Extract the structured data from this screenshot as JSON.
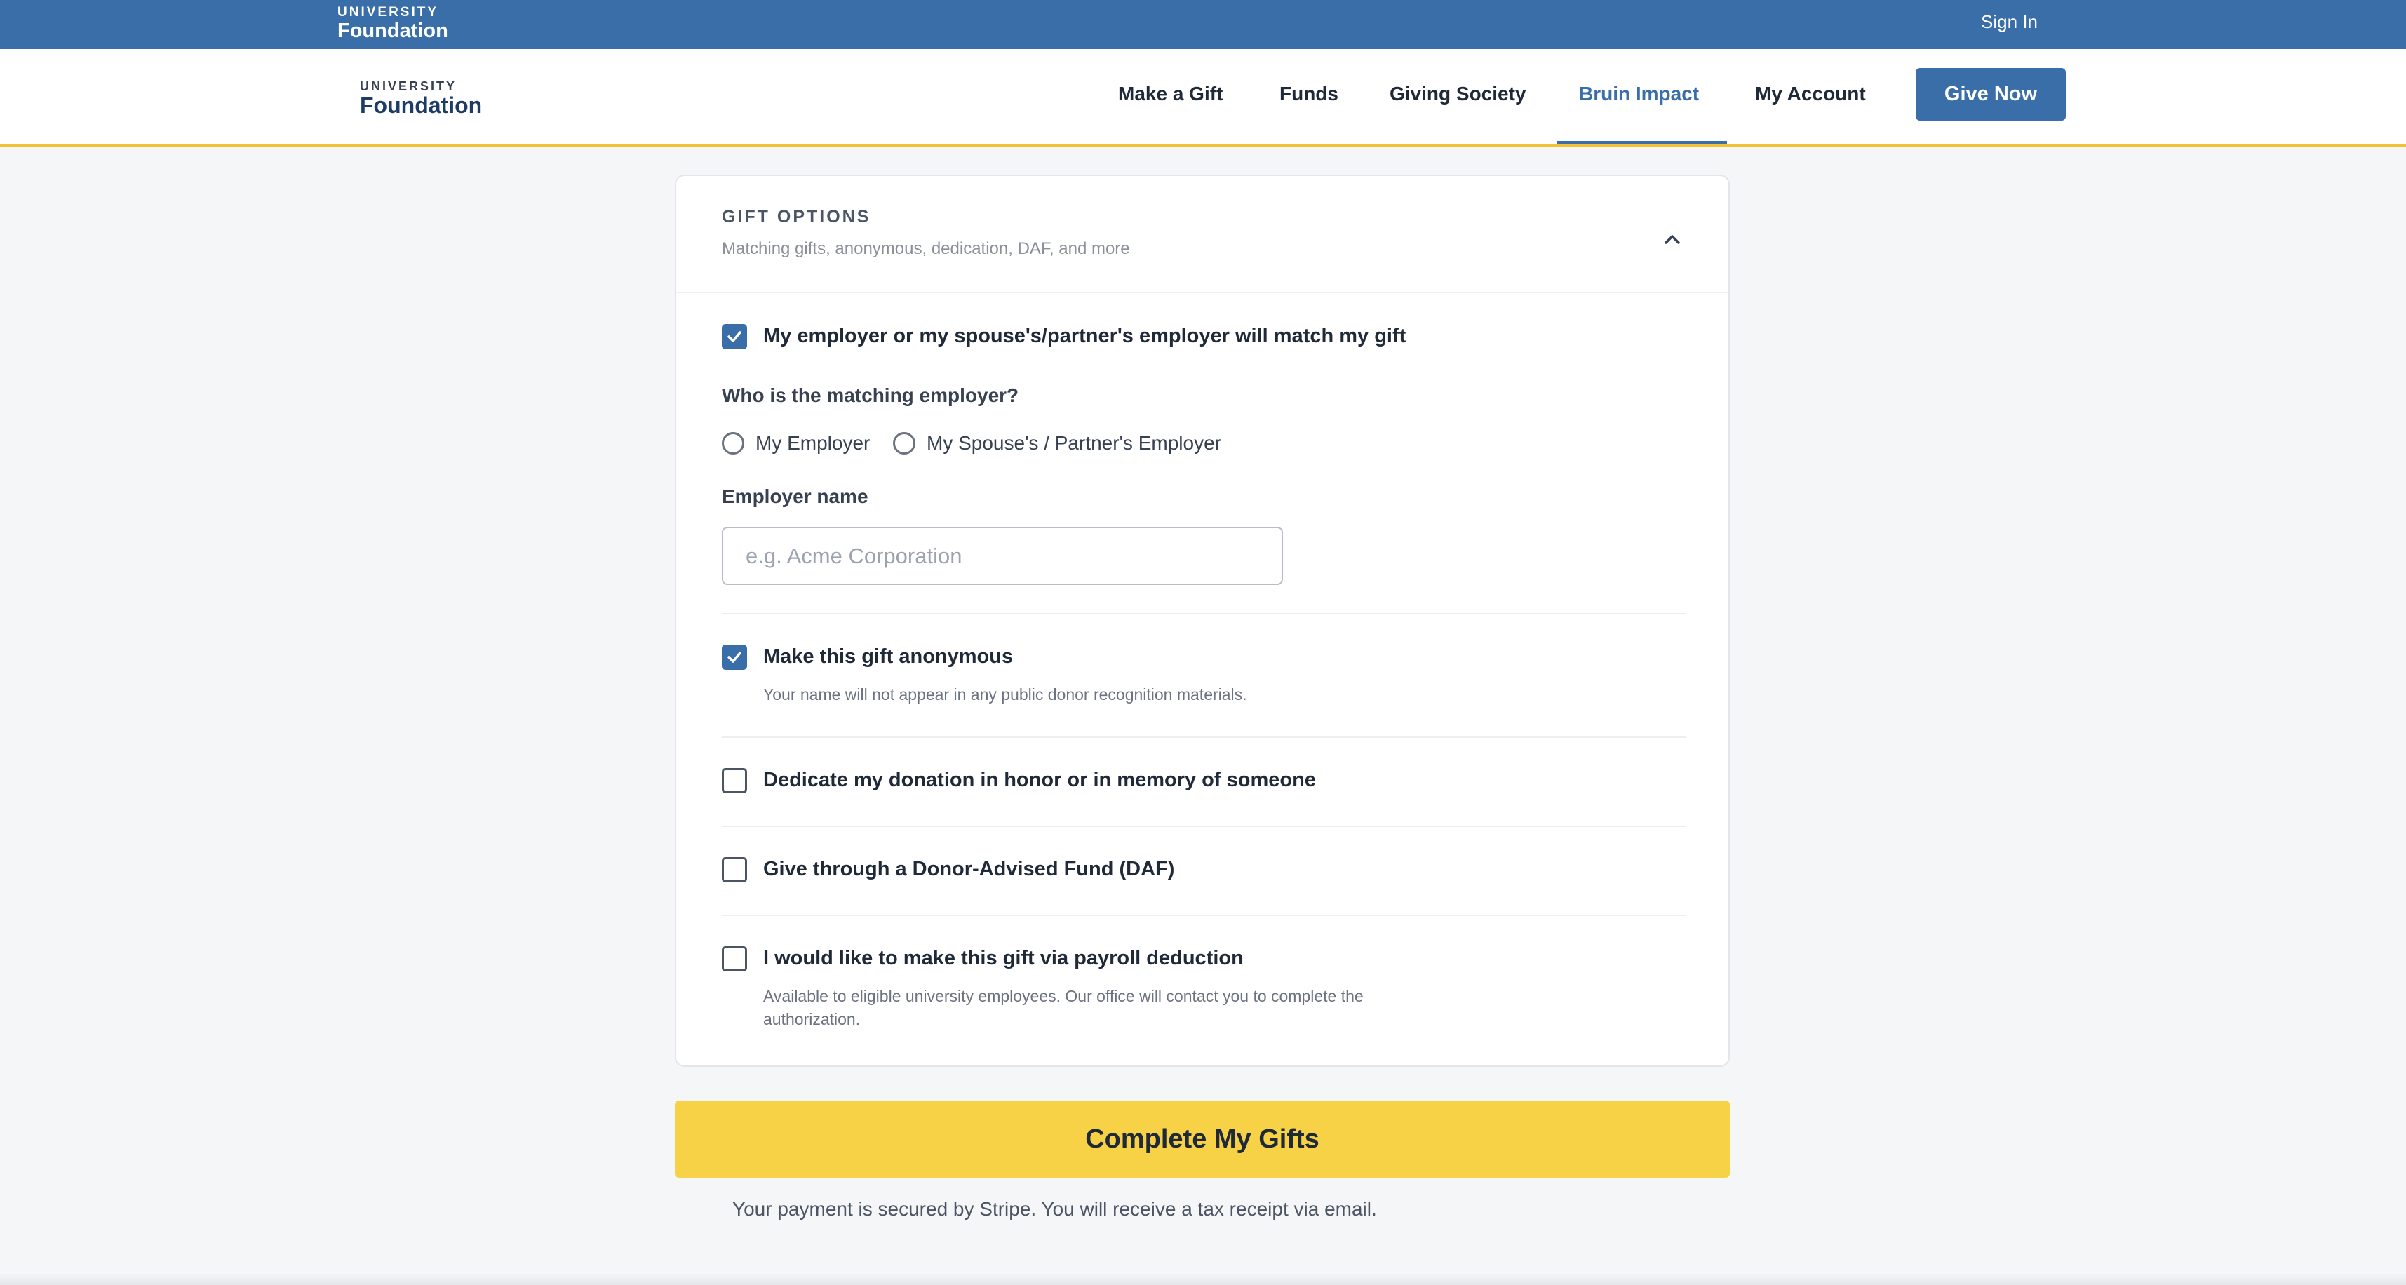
{
  "utility_bar": {
    "logo_small": "UNIVERSITY",
    "logo_big": "Foundation",
    "sign_in": "Sign In"
  },
  "nav": {
    "logo_small": "UNIVERSITY",
    "logo_big": "Foundation",
    "links": [
      "Make a Gift",
      "Funds",
      "Giving Society",
      "Bruin Impact",
      "My Account"
    ],
    "active_link": "Bruin Impact",
    "give_now": "Give Now"
  },
  "gift_options": {
    "title": "GIFT OPTIONS",
    "subtitle": "Matching gifts, anonymous, dedication, DAF, and more",
    "expanded": true,
    "matching": {
      "label": "My employer or my spouse's/partner's employer will match my gift",
      "checked": true,
      "question": "Who is the matching employer?",
      "radio_options": [
        "My Employer",
        "My Spouse's / Partner's Employer"
      ],
      "selected": null,
      "employer_label": "Employer name",
      "employer_placeholder": "e.g. Acme Corporation",
      "employer_value": ""
    },
    "anonymous": {
      "label": "Make this gift anonymous",
      "checked": true,
      "help": "Your name will not appear in any public donor recognition materials."
    },
    "dedicate": {
      "label": "Dedicate my donation in honor or in memory of someone",
      "checked": false
    },
    "daf": {
      "label": "Give through a Donor-Advised Fund (DAF)",
      "checked": false
    },
    "payroll": {
      "label": "I would like to make this gift via payroll deduction",
      "checked": false,
      "help_line1": "Available to eligible university employees. Our office will contact you to complete the",
      "help_line2": "authorization."
    }
  },
  "submit": {
    "label": "Complete My Gifts",
    "note": "Your payment is secured by Stripe. You will receive a tax receipt via email."
  },
  "colors": {
    "primary": "#3a6ea8",
    "accent_yellow": "#f7d247",
    "nav_underline": "#f2c230",
    "background": "#f5f6f8"
  }
}
